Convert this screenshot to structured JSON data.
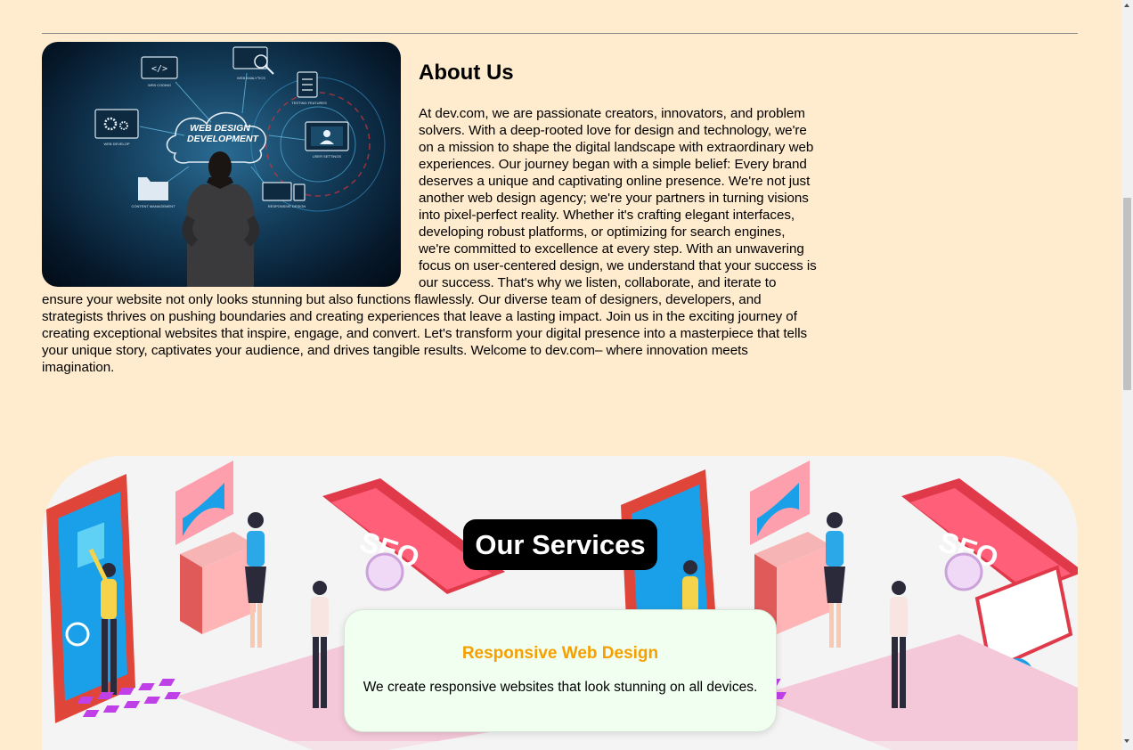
{
  "about": {
    "title": "About Us",
    "body": "At dev.com, we are passionate creators, innovators, and problem solvers. With a deep-rooted love for design and technology, we're on a mission to shape the digital landscape with extraordinary web experiences. Our journey began with a simple belief: Every brand deserves a unique and captivating online presence. We're not just another web design agency; we're your partners in turning visions into pixel-perfect reality. Whether it's crafting elegant interfaces, developing robust platforms, or optimizing for search engines, we're committed to excellence at every step. With an unwavering focus on user-centered design, we understand that your success is our success. That's why we listen, collaborate, and iterate to ensure your website not only looks stunning but also functions flawlessly. Our diverse team of designers, developers, and strategists thrives on pushing boundaries and creating experiences that leave a lasting impact. Join us in the exciting journey of creating exceptional websites that inspire, engage, and convert. Let's transform your digital presence into a masterpiece that tells your unique story, captivates your audience, and drives tangible results. Welcome to dev.com– where innovation meets imagination.",
    "image": {
      "center_line1": "WEB DESIGN",
      "center_line2": "DEVELOPMENT",
      "labels": [
        "WEB CODING",
        "WEB ANALYTICS",
        "WEB DEVELOP",
        "TESTING FEATURES",
        "USER SETTINGS",
        "CONTENT MANAGEMENT",
        "RESPONSIVE DESIGN"
      ]
    }
  },
  "services": {
    "heading": "Our Services",
    "cards": [
      {
        "title": "Responsive Web Design",
        "description": "We create responsive websites that look stunning on all devices."
      }
    ],
    "illustration": {
      "seo_label": "SEO"
    }
  },
  "colors": {
    "page_bg": "#ffebcd",
    "accent": "#f5a000",
    "card_bg": "#f0fff0",
    "heading_bg": "#000000"
  }
}
